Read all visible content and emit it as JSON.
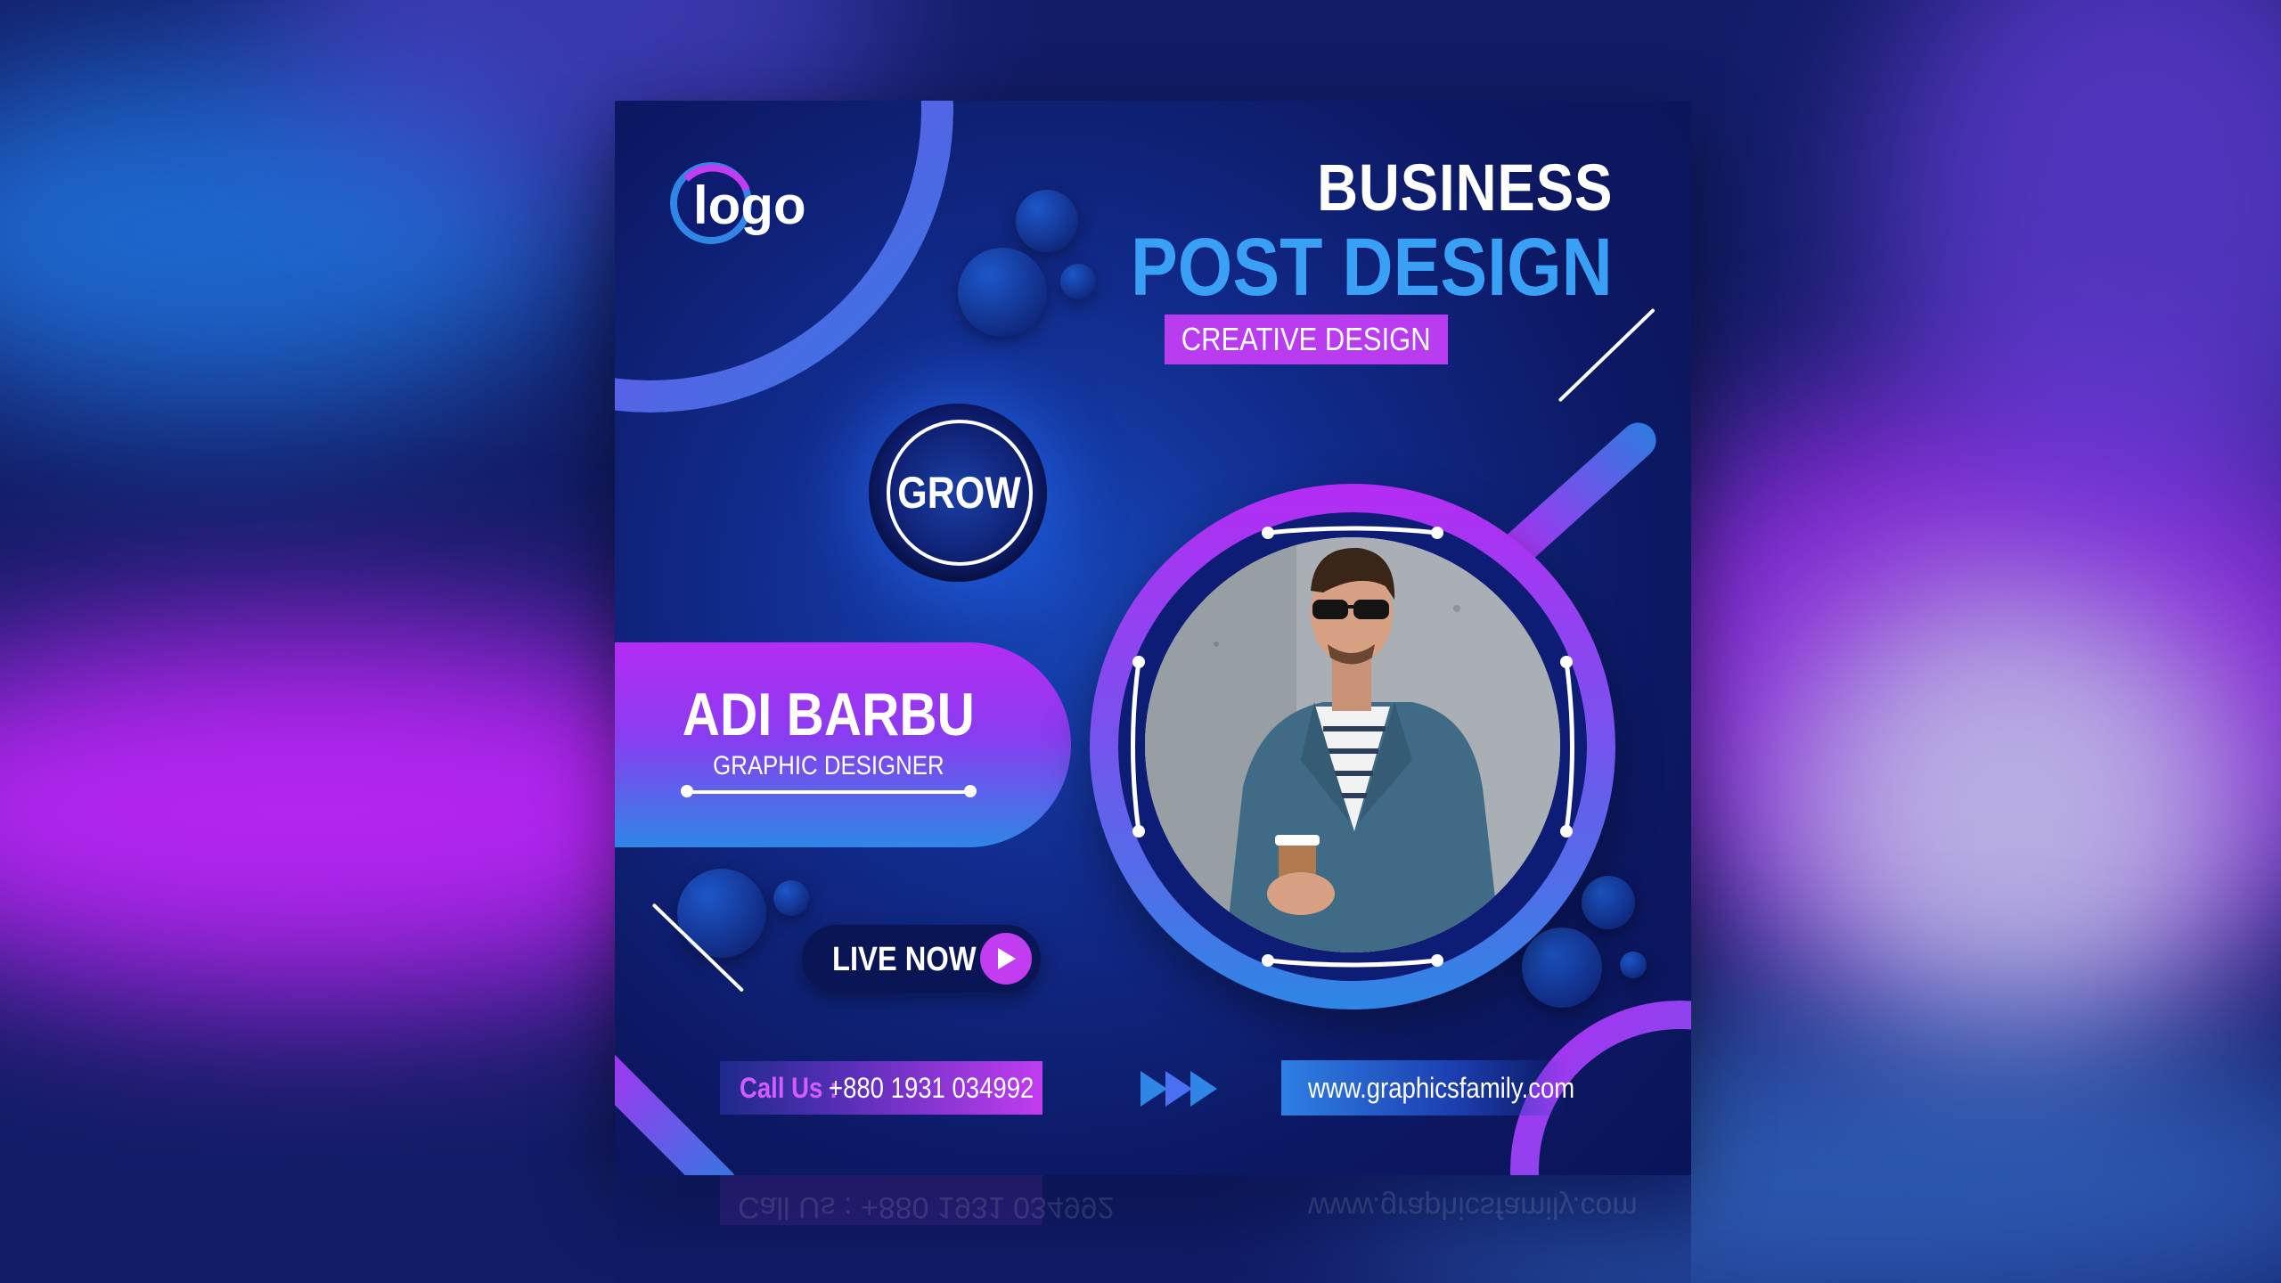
{
  "logo": {
    "text": "logo"
  },
  "heading": {
    "line1": "BUSINESS",
    "line2": "POST DESIGN",
    "tag": "CREATIVE DESIGN"
  },
  "badge": {
    "text": "GROW"
  },
  "person": {
    "name": "ADI BARBU",
    "role": "GRAPHIC DESIGNER"
  },
  "live": {
    "label": "LIVE NOW"
  },
  "contact": {
    "call_label": "Call Us :",
    "phone": "+880 1931 034992",
    "website": "www.graphicsfamily.com"
  },
  "reflection": {
    "call": "Call Us : +880 1931 034992",
    "website": "www.graphicsfamily.com"
  },
  "colors": {
    "accent_purple": "#b52cf4",
    "accent_blue": "#2f7ae0",
    "title_blue": "#3aa0f5",
    "card_bg": "#0c1862"
  },
  "icons": [
    "play-icon",
    "triple-arrow-icon"
  ]
}
